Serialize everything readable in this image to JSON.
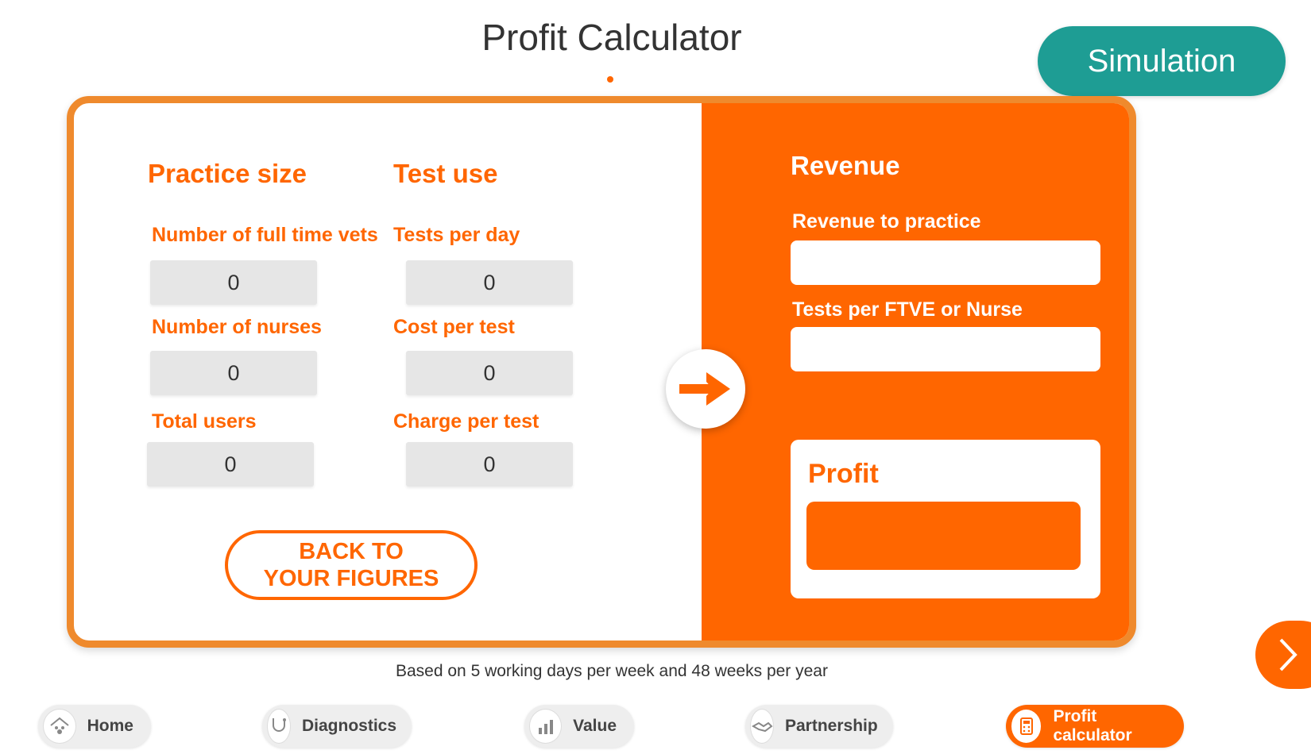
{
  "title": "Profit Calculator",
  "simulation_badge": "Simulation",
  "practice_size": {
    "heading": "Practice size",
    "fields": [
      {
        "label": "Number of full time vets",
        "value": "0"
      },
      {
        "label": "Number of nurses",
        "value": "0"
      },
      {
        "label": "Total users",
        "value": "0"
      }
    ]
  },
  "test_use": {
    "heading": "Test use",
    "fields": [
      {
        "label": "Tests per day",
        "value": "0"
      },
      {
        "label": "Cost per test",
        "value": "0"
      },
      {
        "label": "Charge per test",
        "value": "0"
      }
    ]
  },
  "back_button": {
    "line1": "BACK TO",
    "line2": "YOUR FIGURES"
  },
  "revenue": {
    "heading": "Revenue",
    "revenue_to_practice_label": "Revenue to practice",
    "tests_per_label": "Tests per FTVE or Nurse",
    "profit_label": "Profit"
  },
  "footnote": "Based on 5 working days per week and 48 weeks per year",
  "nav": [
    {
      "label": "Home",
      "icon": "paw-house-icon"
    },
    {
      "label": "Diagnostics",
      "icon": "stethoscope-icon"
    },
    {
      "label": "Value",
      "icon": "bar-chart-icon"
    },
    {
      "label": "Partnership",
      "icon": "handshake-icon"
    },
    {
      "label": "Profit calculator",
      "icon": "calculator-icon",
      "active": true
    }
  ],
  "colors": {
    "accent": "#ff6600",
    "border": "#ef8a2d",
    "teal": "#1e9d94"
  }
}
